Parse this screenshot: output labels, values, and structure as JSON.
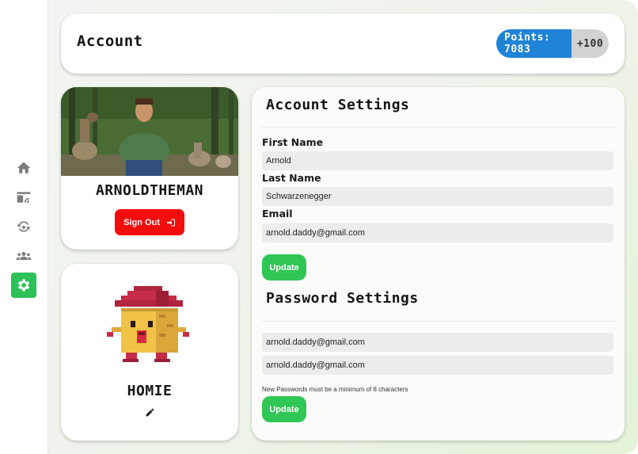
{
  "header": {
    "title": "Account",
    "points_label": "Points: 7083",
    "points_bonus": "+100"
  },
  "sidebar": {
    "items": [
      {
        "icon": "home-icon",
        "active": false
      },
      {
        "icon": "feed-icon",
        "active": false
      },
      {
        "icon": "recycle-icon",
        "active": false
      },
      {
        "icon": "community-icon",
        "active": false
      },
      {
        "icon": "gear-icon",
        "active": true
      }
    ]
  },
  "profile": {
    "username": "ARNOLDTHEMAN",
    "signout_label": "Sign Out"
  },
  "pet": {
    "name": "HOMIE"
  },
  "account_settings": {
    "title": "Account Settings",
    "first_name_label": "First Name",
    "first_name_value": "Arnold",
    "last_name_label": "Last Name",
    "last_name_value": "Schwarzenegger",
    "email_label": "Email",
    "email_value": "arnold.daddy@gmail.com",
    "update_label": "Update"
  },
  "password_settings": {
    "title": "Password Settings",
    "new_password_value": "arnold.daddy@gmail.com",
    "confirm_password_value": "arnold.daddy@gmail.com",
    "note": "New Passwords must be a minimum of 8 characters",
    "update_label": "Update"
  },
  "colors": {
    "accent_green": "#30c655",
    "points_blue": "#1f83d6",
    "signout_red": "#f30d0d"
  }
}
